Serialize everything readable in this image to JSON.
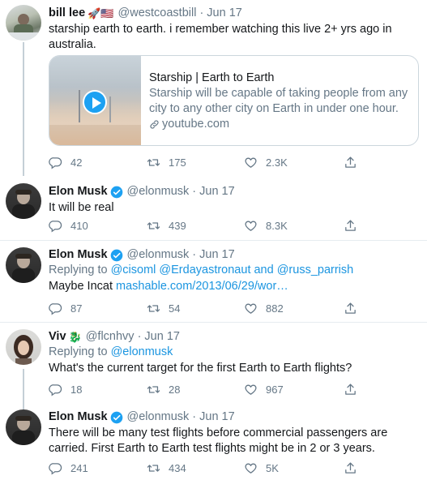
{
  "tweets": [
    {
      "name": "bill lee",
      "emoji": "🚀🇺🇸",
      "handle": "@westcoastbill",
      "date": "Jun 17",
      "text_lines": [
        "starship earth to earth.  i remember watching this live 2+ yrs ago in",
        "australia."
      ],
      "card": {
        "title": "Starship | Earth to Earth",
        "desc_lines": [
          "Starship will be capable of taking people from any",
          "city to any other city on Earth in under one hour."
        ],
        "domain": "youtube.com"
      },
      "actions": {
        "replies": "42",
        "retweets": "175",
        "likes": "2.3K"
      }
    },
    {
      "name": "Elon Musk",
      "handle": "@elonmusk",
      "date": "Jun 17",
      "text": "It will be real",
      "actions": {
        "replies": "410",
        "retweets": "439",
        "likes": "8.3K"
      }
    },
    {
      "name": "Elon Musk",
      "handle": "@elonmusk",
      "date": "Jun 17",
      "replying_prefix": "Replying to ",
      "replying_mentions": "@cisoml @Erdayastronaut and @russ_parrish",
      "text_prefix": "Maybe Incat ",
      "text_link": "mashable.com/2013/06/29/wor…",
      "actions": {
        "replies": "87",
        "retweets": "54",
        "likes": "882"
      }
    },
    {
      "name": "Viv",
      "emoji": "🐉",
      "handle": "@flcnhvy",
      "date": "Jun 17",
      "replying_prefix": "Replying to ",
      "replying_mentions": "@elonmusk",
      "text": "What's the current target for the first Earth to Earth flights?",
      "actions": {
        "replies": "18",
        "retweets": "28",
        "likes": "967"
      }
    },
    {
      "name": "Elon Musk",
      "handle": "@elonmusk",
      "date": "Jun 17",
      "text_lines": [
        "There will be many test flights before commercial passengers are",
        "carried. First Earth to Earth test flights might be in 2 or 3 years."
      ],
      "actions": {
        "replies": "241",
        "retweets": "434",
        "likes": "5K"
      }
    }
  ],
  "dot": "·",
  "colors": {
    "link": "#1b95e0",
    "muted": "#657786",
    "verified": "#1da1f2"
  }
}
